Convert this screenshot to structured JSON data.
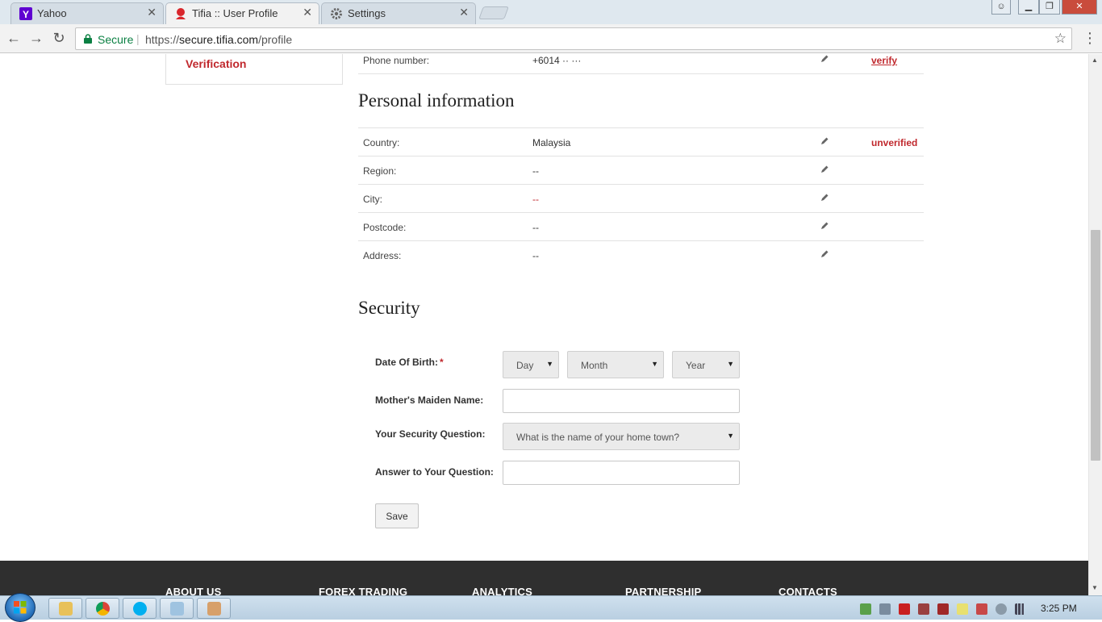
{
  "browser": {
    "tabs": [
      {
        "title": "Yahoo",
        "icon": "yahoo-icon",
        "active": false
      },
      {
        "title": "Tifia :: User Profile",
        "icon": "tifia-icon",
        "active": true
      },
      {
        "title": "Settings",
        "icon": "gear-icon",
        "active": false
      }
    ],
    "address": {
      "secure_label": "Secure",
      "separator": "|",
      "url_prefix": "https://",
      "url_host": "secure.tifia.com",
      "url_path": "/profile"
    }
  },
  "sidebar": {
    "verification_link": "Verification"
  },
  "contact_rows": [
    {
      "label": "Phone number:",
      "value": "+6014 ·· ···",
      "status": "verify"
    }
  ],
  "personal_information": {
    "title": "Personal information",
    "rows": [
      {
        "label": "Country:",
        "value": "Malaysia",
        "status": "unverified"
      },
      {
        "label": "Region:",
        "value": "--",
        "status": ""
      },
      {
        "label": "City:",
        "value": "--",
        "status": ""
      },
      {
        "label": "Postcode:",
        "value": "--",
        "status": ""
      },
      {
        "label": "Address:",
        "value": "--",
        "status": ""
      }
    ]
  },
  "security": {
    "title": "Security",
    "dob_label": "Date Of Birth:",
    "required_mark": "*",
    "day_placeholder": "Day",
    "month_placeholder": "Month",
    "year_placeholder": "Year",
    "maiden_name_label": "Mother's Maiden Name:",
    "maiden_name_value": "",
    "question_label": "Your Security Question:",
    "question_selected": "What is the name of your home town?",
    "answer_label": "Answer to Your Question:",
    "answer_value": "",
    "save_label": "Save"
  },
  "footer": {
    "headings": [
      "ABOUT US",
      "FOREX TRADING",
      "ANALYTICS",
      "PARTNERSHIP",
      "CONTACTS"
    ]
  },
  "taskbar": {
    "clock": "3:25 PM"
  },
  "colors": {
    "accent_red": "#c0282d",
    "footer_bg": "#2f2f2f",
    "secure_green": "#0b8043"
  }
}
